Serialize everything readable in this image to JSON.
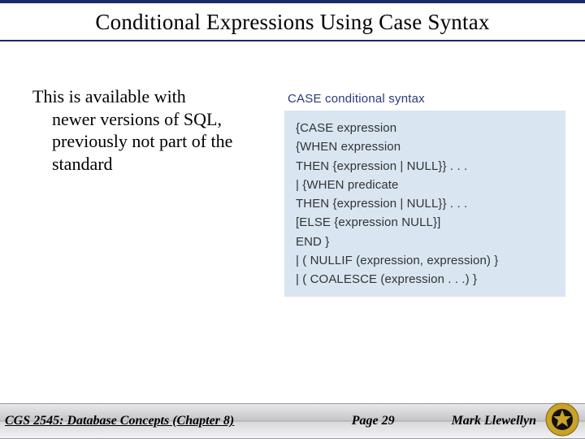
{
  "title": "Conditional Expressions Using Case Syntax",
  "body": {
    "first_line": "This is available with",
    "rest": "newer versions of SQL, previously not part of the standard"
  },
  "syntax": {
    "caption": "CASE conditional syntax",
    "lines": [
      "{CASE expression",
      "{WHEN expression",
      "THEN {expression | NULL}} . . .",
      "| {WHEN predicate",
      "THEN {expression | NULL}} . . .",
      "[ELSE {expression  NULL}]",
      "END }",
      "| ( NULLIF (expression, expression) }",
      "| ( COALESCE (expression . . .) }"
    ]
  },
  "footer": {
    "course": "CGS 2545: Database Concepts  (Chapter 8)",
    "page": "Page 29",
    "author": "Mark Llewellyn"
  }
}
